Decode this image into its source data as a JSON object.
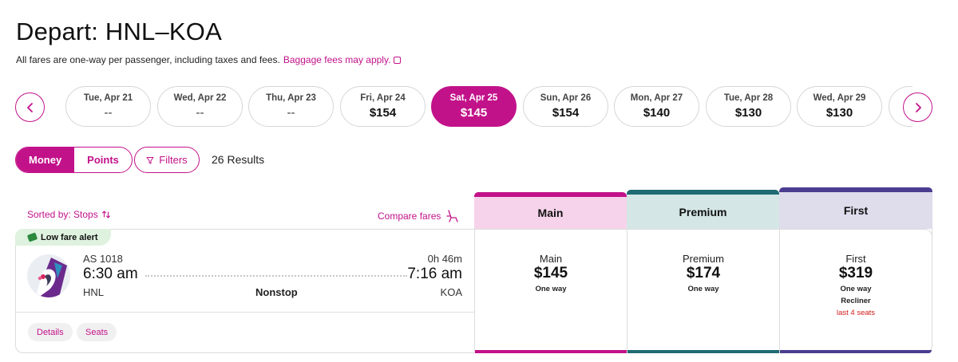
{
  "header": {
    "title": "Depart: HNL–KOA",
    "subtitle": "All fares are one-way per passenger, including taxes and fees.",
    "baggage_link": "Baggage fees may apply."
  },
  "dates": [
    {
      "day": "Tue, Apr 21",
      "price": "--"
    },
    {
      "day": "Wed, Apr 22",
      "price": "--"
    },
    {
      "day": "Thu, Apr 23",
      "price": "--"
    },
    {
      "day": "Fri, Apr 24",
      "price": "$154"
    },
    {
      "day": "Sat, Apr 25",
      "price": "$145"
    },
    {
      "day": "Sun, Apr 26",
      "price": "$154"
    },
    {
      "day": "Mon, Apr 27",
      "price": "$140"
    },
    {
      "day": "Tue, Apr 28",
      "price": "$130"
    },
    {
      "day": "Wed, Apr 29",
      "price": "$130"
    }
  ],
  "controls": {
    "money_label": "Money",
    "points_label": "Points",
    "filters_label": "Filters",
    "results_text": "26 Results",
    "sorted_label": "Sorted by: Stops",
    "compare_label": "Compare fares"
  },
  "flight": {
    "alert": "Low fare alert",
    "flight_number": "AS 1018",
    "depart_time": "6:30 am",
    "arrive_time": "7:16 am",
    "duration": "0h 46m",
    "origin": "HNL",
    "destination": "KOA",
    "stops": "Nonstop",
    "details_label": "Details",
    "seats_label": "Seats"
  },
  "fares": [
    {
      "header": "Main",
      "name": "Main",
      "price": "$145",
      "note": "One way",
      "accent": "#c2128a",
      "header_bg": "#f6d3ea"
    },
    {
      "header": "Premium",
      "name": "Premium",
      "price": "$174",
      "note": "One way",
      "accent": "#1f6b73",
      "header_bg": "#d4e6e6"
    },
    {
      "header": "First",
      "name": "First",
      "price": "$319",
      "note": "One way",
      "cabin": "Recliner",
      "seats_left": "last 4 seats",
      "accent": "#4a3d8f",
      "header_bg": "#dfdcec"
    }
  ],
  "colors": {
    "brand": "#c2128a",
    "alert_red": "#d21a1a",
    "alert_green_bg": "#dff2df"
  },
  "icons": [
    "chevron-left-icon",
    "chevron-right-icon",
    "filter-icon",
    "sort-icon",
    "seat-icon",
    "tag-icon",
    "external-link-icon"
  ]
}
